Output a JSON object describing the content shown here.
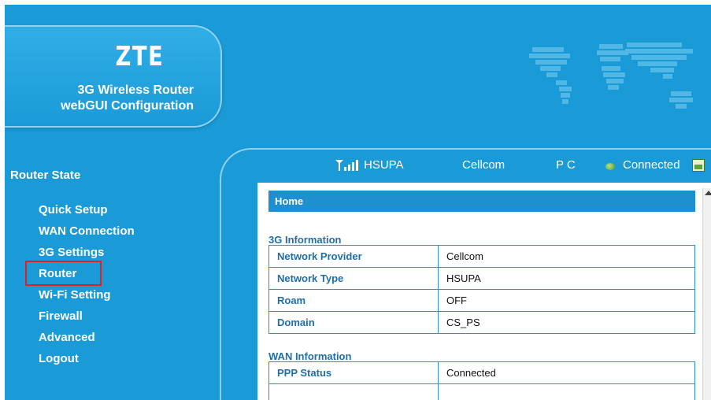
{
  "brand": {
    "logo": "ZTE",
    "subtitle_line1": "3G Wireless Router",
    "subtitle_line2": "webGUI Configuration"
  },
  "sidebar": {
    "title": "Router State",
    "items": [
      {
        "label": "Quick Setup"
      },
      {
        "label": "WAN Connection"
      },
      {
        "label": "3G Settings"
      },
      {
        "label": "Router",
        "selected": true
      },
      {
        "label": "Wi-Fi Setting"
      },
      {
        "label": "Firewall"
      },
      {
        "label": "Advanced"
      },
      {
        "label": "Logout"
      }
    ]
  },
  "status": {
    "signal_icon": "signal-bars-icon",
    "network": "HSUPA",
    "provider": "Cellcom",
    "mode": "P C",
    "connection": "Connected",
    "connection_icon": "green-dot-icon",
    "pc_icon": "pc-icon"
  },
  "main": {
    "header": "Home",
    "sections": [
      {
        "title": "3G Information",
        "rows": [
          {
            "key": "Network Provider",
            "value": "Cellcom"
          },
          {
            "key": "Network Type",
            "value": "HSUPA"
          },
          {
            "key": "Roam",
            "value": "OFF"
          },
          {
            "key": "Domain",
            "value": "CS_PS"
          }
        ]
      },
      {
        "title": "WAN Information",
        "rows": [
          {
            "key": "PPP Status",
            "value": "Connected"
          }
        ]
      }
    ]
  },
  "colors": {
    "background": "#1a9ad7",
    "highlight_border": "#e0201f",
    "table_border": "#2a91cf",
    "header_bar": "#1e8fcf"
  }
}
